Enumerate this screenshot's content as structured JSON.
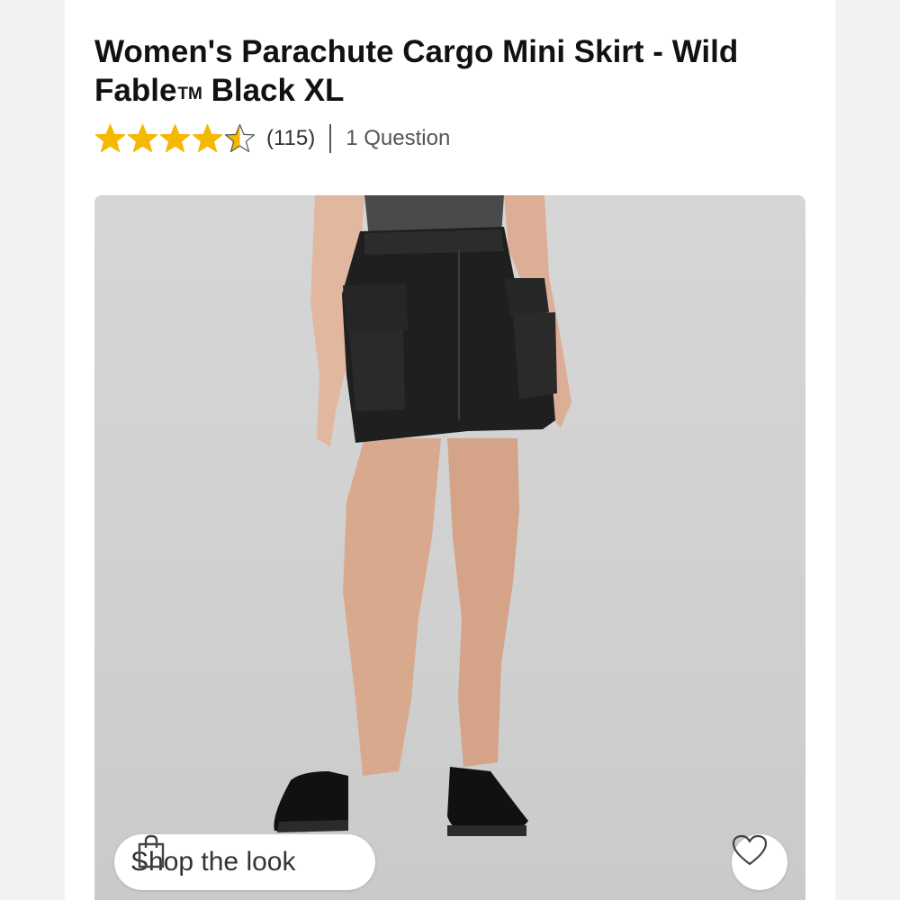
{
  "product": {
    "title_main": "Women's Parachute Cargo Mini Skirt - Wild Fable",
    "title_tm": "TM",
    "title_rest": " Black XL"
  },
  "rating": {
    "stars": 4.5,
    "max_stars": 5,
    "review_count": "(115)",
    "questions": "1 Question",
    "star_color": "#f5b800"
  },
  "image": {
    "shop_the_look": "Shop the look",
    "icons": [
      "shopping-bag-icon",
      "heart-icon"
    ]
  }
}
